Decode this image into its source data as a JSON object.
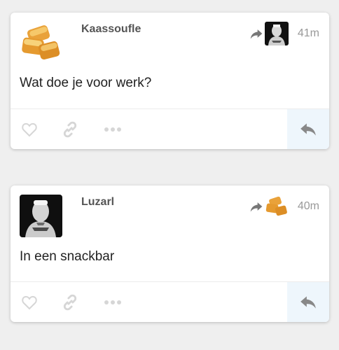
{
  "posts": [
    {
      "author": "Kaassoufle",
      "text": "Wat doe je voor werk?",
      "time": "41m",
      "avatar_icon": "kaassoufle-snack-icon",
      "reply_to_avatar_icon": "luzarl-portrait-icon"
    },
    {
      "author": "Luzarl",
      "text": "In een snackbar",
      "time": "40m",
      "avatar_icon": "luzarl-portrait-icon",
      "reply_to_avatar_icon": "kaassoufle-snack-icon"
    }
  ],
  "icons": {
    "like": "heart-icon",
    "share": "link-icon",
    "more": "more-dots-icon",
    "reply": "reply-arrow-icon",
    "reply_to": "forward-arrow-icon"
  },
  "colors": {
    "background": "#efefef",
    "card": "#ffffff",
    "author": "#555555",
    "time": "#999999",
    "icon": "#d6d6d6",
    "reply_bg": "#eef6fc",
    "reply_icon": "#888888"
  }
}
